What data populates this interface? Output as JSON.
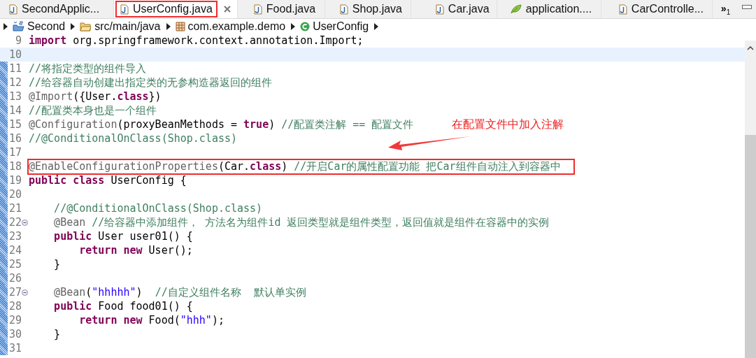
{
  "tabs": [
    {
      "label": "SecondApplic...",
      "kind": "java",
      "selected": false,
      "boxed": false
    },
    {
      "label": "UserConfig.java",
      "kind": "java",
      "selected": true,
      "boxed": true
    },
    {
      "label": "Food.java",
      "kind": "java",
      "selected": false,
      "boxed": false
    },
    {
      "label": "Shop.java",
      "kind": "java",
      "selected": false,
      "boxed": false
    },
    {
      "label": "Car.java",
      "kind": "java",
      "selected": false,
      "boxed": false
    },
    {
      "label": "application....",
      "kind": "leaf",
      "selected": false,
      "boxed": false
    },
    {
      "label": "CarControlle...",
      "kind": "java",
      "selected": false,
      "boxed": false
    }
  ],
  "overflow": {
    "glyph": "»",
    "count": "1"
  },
  "breadcrumb": [
    {
      "label": "Second",
      "kind": "project"
    },
    {
      "label": "src/main/java",
      "kind": "folder"
    },
    {
      "label": "com.example.demo",
      "kind": "package"
    },
    {
      "label": "UserConfig",
      "kind": "class"
    }
  ],
  "code_lines": [
    {
      "number": "9",
      "highlighted": false,
      "boxed": false,
      "fold": false,
      "changed": false,
      "tokens": [
        {
          "kind": "keyword",
          "text": "import"
        },
        {
          "kind": "plain",
          "text": " org.springframework.context.annotation.Import;"
        }
      ]
    },
    {
      "number": "10",
      "highlighted": true,
      "boxed": false,
      "fold": false,
      "changed": false
    },
    {
      "number": "11",
      "highlighted": false,
      "boxed": false,
      "fold": false,
      "changed": true,
      "tokens": [
        {
          "kind": "comment",
          "text": "//将指定类型的组件导入"
        }
      ]
    },
    {
      "number": "12",
      "highlighted": false,
      "boxed": false,
      "fold": false,
      "changed": true,
      "tokens": [
        {
          "kind": "comment",
          "text": "//给容器自动创建出指定类的无参构造器返回的组件"
        }
      ]
    },
    {
      "number": "13",
      "highlighted": false,
      "boxed": false,
      "fold": false,
      "changed": true,
      "tokens": [
        {
          "kind": "annotation",
          "text": "@Import"
        },
        {
          "kind": "plain",
          "text": "({User."
        },
        {
          "kind": "keyword",
          "text": "class"
        },
        {
          "kind": "plain",
          "text": "})"
        }
      ]
    },
    {
      "number": "14",
      "highlighted": false,
      "boxed": false,
      "fold": false,
      "changed": true,
      "tokens": [
        {
          "kind": "comment",
          "text": "//配置类本身也是一个组件"
        }
      ]
    },
    {
      "number": "15",
      "highlighted": false,
      "boxed": false,
      "fold": false,
      "changed": true,
      "tokens": [
        {
          "kind": "annotation",
          "text": "@Configuration"
        },
        {
          "kind": "plain",
          "text": "(proxyBeanMethods = "
        },
        {
          "kind": "keyword",
          "text": "true"
        },
        {
          "kind": "plain",
          "text": ") "
        },
        {
          "kind": "comment",
          "text": "//配置类注解 == 配置文件"
        }
      ]
    },
    {
      "number": "16",
      "highlighted": false,
      "boxed": false,
      "fold": false,
      "changed": true,
      "tokens": [
        {
          "kind": "comment",
          "text": "//@ConditionalOnClass(Shop.class)"
        }
      ]
    },
    {
      "number": "17",
      "highlighted": false,
      "boxed": false,
      "fold": false,
      "changed": true
    },
    {
      "number": "18",
      "highlighted": false,
      "boxed": true,
      "fold": false,
      "changed": true,
      "tokens": [
        {
          "kind": "annotation",
          "text": "@EnableConfigurationProperties"
        },
        {
          "kind": "plain",
          "text": "(Car."
        },
        {
          "kind": "keyword",
          "text": "class"
        },
        {
          "kind": "plain",
          "text": ") "
        },
        {
          "kind": "comment",
          "text": "//开启Car的属性配置功能 把Car组件自动注入到容器中"
        }
      ]
    },
    {
      "number": "19",
      "highlighted": false,
      "boxed": false,
      "fold": false,
      "changed": true,
      "tokens": [
        {
          "kind": "keyword",
          "text": "public class"
        },
        {
          "kind": "plain",
          "text": " UserConfig {"
        }
      ]
    },
    {
      "number": "20",
      "highlighted": false,
      "boxed": false,
      "fold": false,
      "changed": true
    },
    {
      "number": "21",
      "highlighted": false,
      "boxed": false,
      "fold": false,
      "changed": true,
      "tokens": [
        {
          "kind": "comment",
          "text": "    //@ConditionalOnClass(Shop.class)"
        }
      ]
    },
    {
      "number": "22",
      "highlighted": false,
      "boxed": false,
      "fold": true,
      "changed": true,
      "tokens": [
        {
          "kind": "annotation",
          "text": "    @Bean"
        },
        {
          "kind": "comment",
          "text": " //给容器中添加组件， 方法名为组件id 返回类型就是组件类型，返回值就是组件在容器中的实例"
        }
      ]
    },
    {
      "number": "23",
      "highlighted": false,
      "boxed": false,
      "fold": false,
      "changed": true,
      "tokens": [
        {
          "kind": "keyword",
          "text": "    public"
        },
        {
          "kind": "plain",
          "text": " User user01() {"
        }
      ]
    },
    {
      "number": "24",
      "highlighted": false,
      "boxed": false,
      "fold": false,
      "changed": true,
      "tokens": [
        {
          "kind": "keyword",
          "text": "        return new"
        },
        {
          "kind": "plain",
          "text": " User();"
        }
      ]
    },
    {
      "number": "25",
      "highlighted": false,
      "boxed": false,
      "fold": false,
      "changed": true,
      "tokens": [
        {
          "kind": "plain",
          "text": "    }"
        }
      ]
    },
    {
      "number": "26",
      "highlighted": false,
      "boxed": false,
      "fold": false,
      "changed": true
    },
    {
      "number": "27",
      "highlighted": false,
      "boxed": false,
      "fold": true,
      "changed": true,
      "tokens": [
        {
          "kind": "annotation",
          "text": "    @Bean"
        },
        {
          "kind": "plain",
          "text": "("
        },
        {
          "kind": "string",
          "text": "\"hhhhh\""
        },
        {
          "kind": "plain",
          "text": ")  "
        },
        {
          "kind": "comment",
          "text": "//自定义组件名称  默认单实例"
        }
      ]
    },
    {
      "number": "28",
      "highlighted": false,
      "boxed": false,
      "fold": false,
      "changed": true,
      "tokens": [
        {
          "kind": "keyword",
          "text": "    public"
        },
        {
          "kind": "plain",
          "text": " Food food01() {"
        }
      ]
    },
    {
      "number": "29",
      "highlighted": false,
      "boxed": false,
      "fold": false,
      "changed": true,
      "tokens": [
        {
          "kind": "keyword",
          "text": "        return new"
        },
        {
          "kind": "plain",
          "text": " Food("
        },
        {
          "kind": "string",
          "text": "\"hhh\""
        },
        {
          "kind": "plain",
          "text": ");"
        }
      ]
    },
    {
      "number": "30",
      "highlighted": false,
      "boxed": false,
      "fold": false,
      "changed": true,
      "tokens": [
        {
          "kind": "plain",
          "text": "    }"
        }
      ]
    },
    {
      "number": "31",
      "highlighted": false,
      "boxed": false,
      "fold": false,
      "changed": true
    }
  ],
  "callout": {
    "text": "在配置文件中加入注解"
  }
}
